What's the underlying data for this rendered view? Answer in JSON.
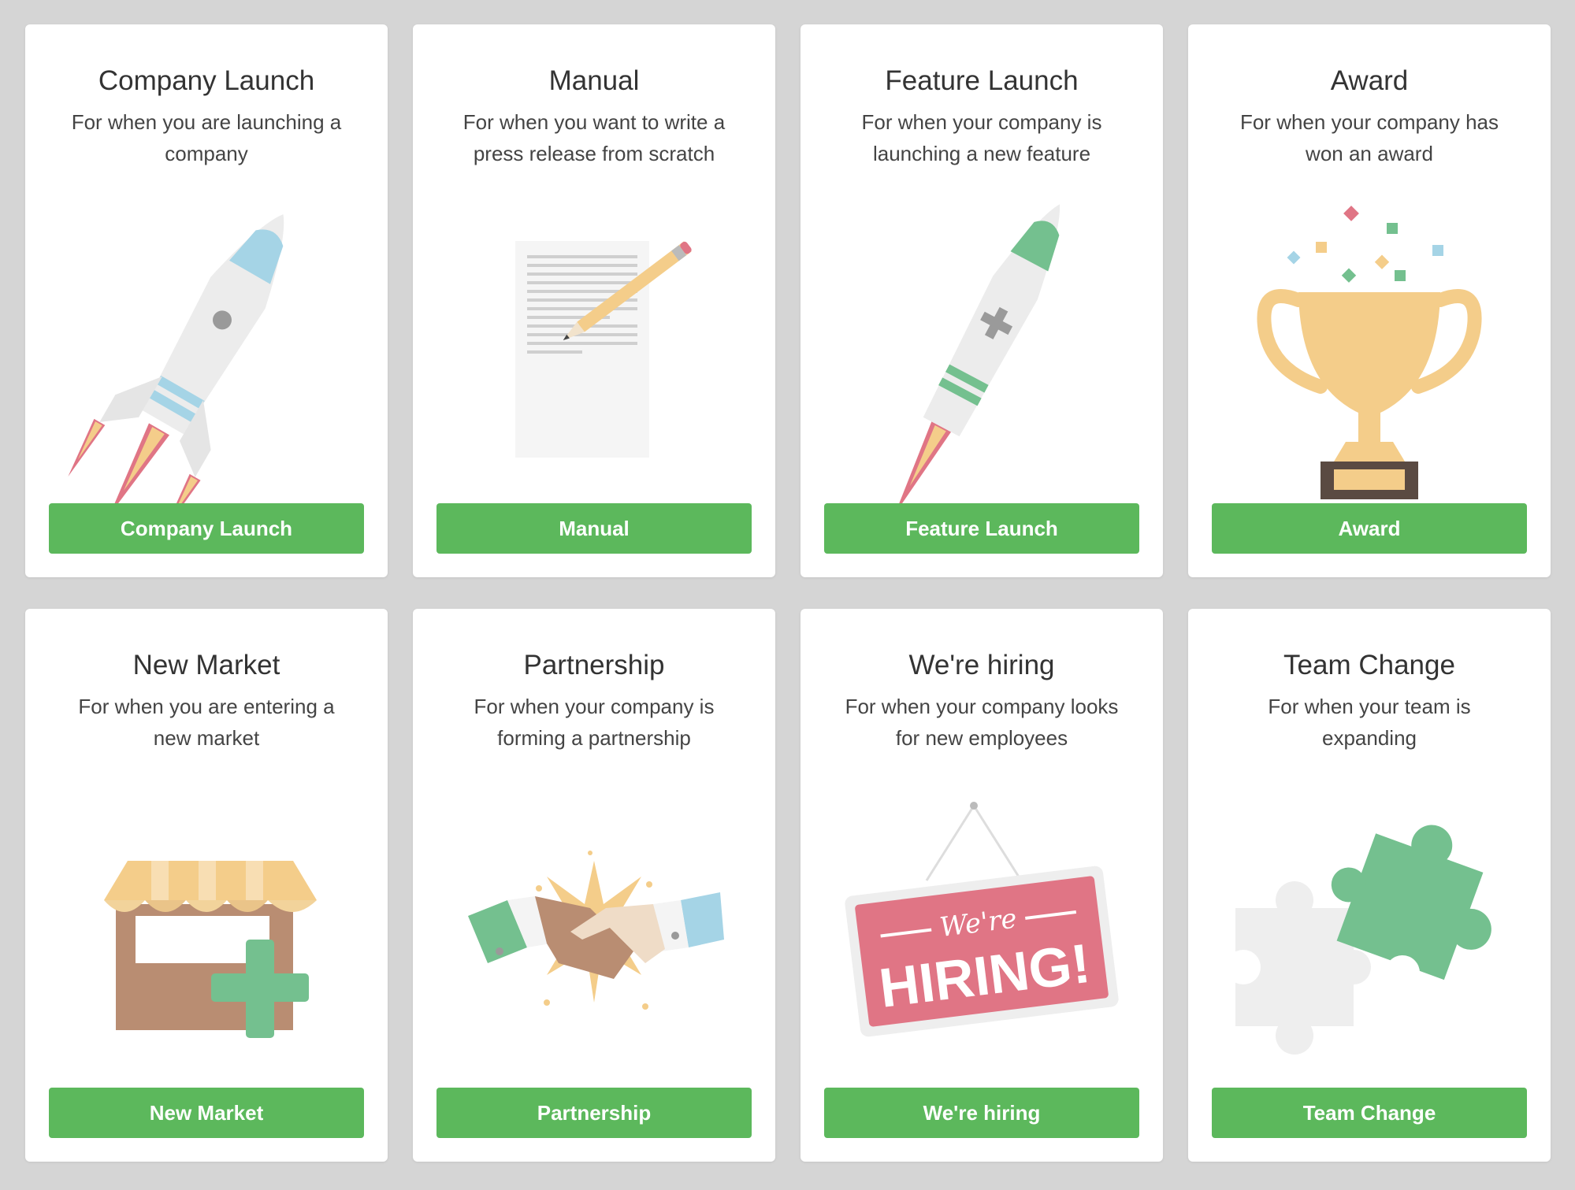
{
  "colors": {
    "background": "#d5d5d5",
    "card": "#ffffff",
    "button": "#5cb85c",
    "button_text": "#ffffff",
    "accent_blue": "#a5d4e6",
    "accent_green": "#74c08f",
    "accent_pink": "#e07585",
    "accent_gold": "#f4cd8a"
  },
  "cards": [
    {
      "title": "Company Launch",
      "description": "For when you are launching a company",
      "button": "Company Launch",
      "icon": "rocket-icon"
    },
    {
      "title": "Manual",
      "description": "For when you want to write a press release from scratch",
      "button": "Manual",
      "icon": "document-pencil-icon"
    },
    {
      "title": "Feature Launch",
      "description": "For when your company is launching a new feature",
      "button": "Feature Launch",
      "icon": "rocket-plus-icon"
    },
    {
      "title": "Award",
      "description": "For when your company has won an award",
      "button": "Award",
      "icon": "trophy-icon"
    },
    {
      "title": "New Market",
      "description": "For when you are entering a new market",
      "button": "New Market",
      "icon": "storefront-plus-icon"
    },
    {
      "title": "Partnership",
      "description": "For when your company is forming a partnership",
      "button": "Partnership",
      "icon": "handshake-icon"
    },
    {
      "title": "We're hiring",
      "description": "For when your company looks for new employees",
      "button": "We're hiring",
      "icon": "hiring-sign-icon",
      "sign": {
        "top": "We're",
        "bottom": "HIRING!"
      }
    },
    {
      "title": "Team Change",
      "description": "For when your team is expanding",
      "button": "Team Change",
      "icon": "puzzle-pieces-icon"
    }
  ]
}
